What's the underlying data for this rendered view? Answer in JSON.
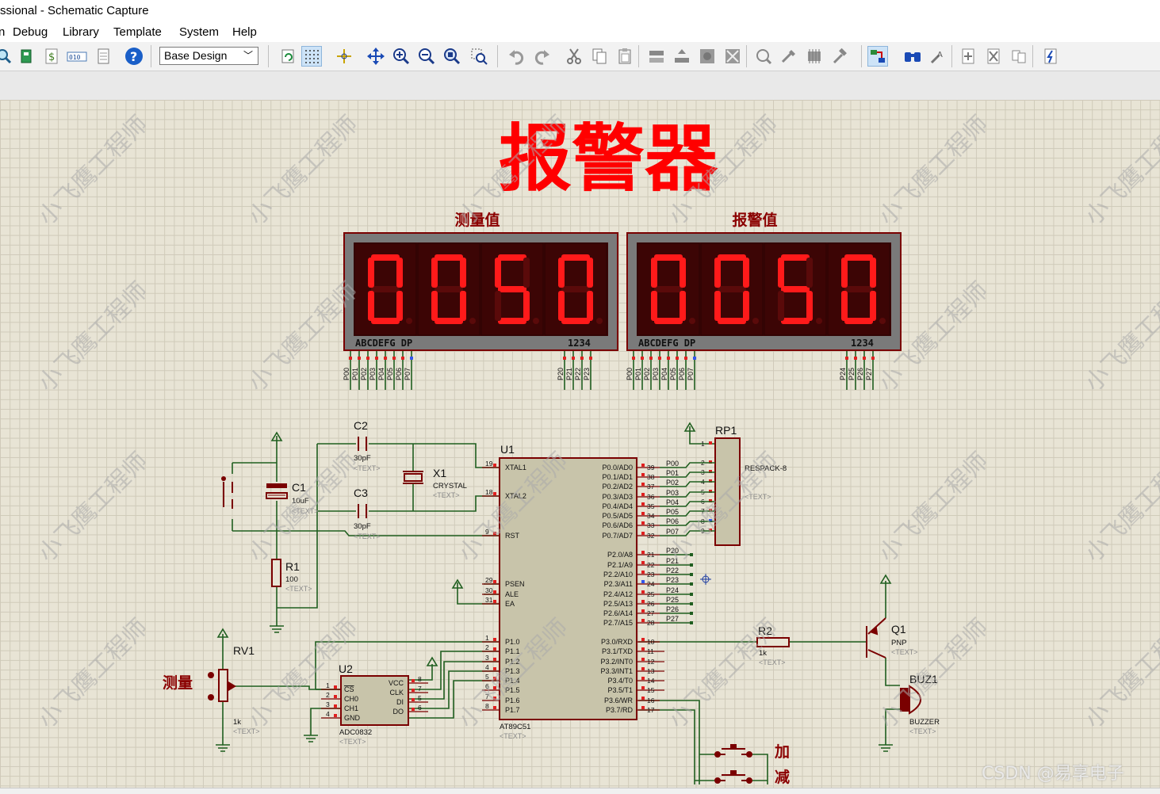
{
  "window": {
    "title": "ssional - Schematic Capture"
  },
  "menu": {
    "items": [
      "n",
      "Debug",
      "Library",
      "Template",
      "System",
      "Help"
    ]
  },
  "toolbar": {
    "layer_select": "Base Design",
    "icons": [
      "zoom-icon",
      "component-icon",
      "dollar-icon",
      "binary-icon",
      "document-icon",
      "help-icon",
      "refresh-icon",
      "grid-icon",
      "origin-icon",
      "pan-icon",
      "zoom-in-icon",
      "zoom-out-icon",
      "zoom-all-icon",
      "zoom-area-icon",
      "undo-icon",
      "redo-icon",
      "cut-icon",
      "copy-icon",
      "paste-icon",
      "block-copy-icon",
      "block-move-icon",
      "block-rotate-icon",
      "block-delete-icon",
      "pick-device-icon",
      "make-device-icon",
      "packaging-icon",
      "decompose-icon",
      "wire-autorouter-icon",
      "search-icon",
      "property-assign-icon",
      "new-sheet-icon",
      "delete-sheet-icon",
      "goto-sheet-icon",
      "netlist-icon"
    ]
  },
  "schematic": {
    "title": "报警器",
    "display1": {
      "caption": "测量值",
      "digits": "0050",
      "seg_label": "ABCDEFG  DP",
      "digit_label": "1234",
      "pins_a": [
        "P00",
        "P01",
        "P02",
        "P03",
        "P04",
        "P05",
        "P06",
        "P07"
      ],
      "pins_b": [
        "P20",
        "P21",
        "P22",
        "P23"
      ]
    },
    "display2": {
      "caption": "报警值",
      "digits": "0050",
      "seg_label": "ABCDEFG  DP",
      "digit_label": "1234",
      "pins_a": [
        "P00",
        "P01",
        "P02",
        "P03",
        "P04",
        "P05",
        "P06",
        "P07"
      ],
      "pins_b": [
        "P24",
        "P25",
        "P26",
        "P27"
      ]
    },
    "u1": {
      "ref": "U1",
      "part": "AT89C51",
      "text": "<TEXT>",
      "left_pins": [
        [
          "19",
          "XTAL1"
        ],
        [
          "18",
          "XTAL2"
        ],
        [
          "9",
          "RST"
        ],
        [
          "29",
          "PSEN"
        ],
        [
          "30",
          "ALE"
        ],
        [
          "31",
          "EA"
        ],
        [
          "1",
          "P1.0"
        ],
        [
          "2",
          "P1.1"
        ],
        [
          "3",
          "P1.2"
        ],
        [
          "4",
          "P1.3"
        ],
        [
          "5",
          "P1.4"
        ],
        [
          "6",
          "P1.5"
        ],
        [
          "7",
          "P1.6"
        ],
        [
          "8",
          "P1.7"
        ]
      ],
      "right_pins": [
        [
          "39",
          "P0.0/AD0",
          "P00"
        ],
        [
          "38",
          "P0.1/AD1",
          "P01"
        ],
        [
          "37",
          "P0.2/AD2",
          "P02"
        ],
        [
          "36",
          "P0.3/AD3",
          "P03"
        ],
        [
          "35",
          "P0.4/AD4",
          "P04"
        ],
        [
          "34",
          "P0.5/AD5",
          "P05"
        ],
        [
          "33",
          "P0.6/AD6",
          "P06"
        ],
        [
          "32",
          "P0.7/AD7",
          "P07"
        ],
        [
          "21",
          "P2.0/A8",
          "P20"
        ],
        [
          "22",
          "P2.1/A9",
          "P21"
        ],
        [
          "23",
          "P2.2/A10",
          "P22"
        ],
        [
          "24",
          "P2.3/A11",
          "P23"
        ],
        [
          "25",
          "P2.4/A12",
          "P24"
        ],
        [
          "26",
          "P2.5/A13",
          "P25"
        ],
        [
          "27",
          "P2.6/A14",
          "P26"
        ],
        [
          "28",
          "P2.7/A15",
          "P27"
        ],
        [
          "10",
          "P3.0/RXD",
          ""
        ],
        [
          "11",
          "P3.1/TXD",
          ""
        ],
        [
          "12",
          "P3.2/INT0",
          ""
        ],
        [
          "13",
          "P3.3/INT1",
          ""
        ],
        [
          "14",
          "P3.4/T0",
          ""
        ],
        [
          "15",
          "P3.5/T1",
          ""
        ],
        [
          "16",
          "P3.6/WR",
          ""
        ],
        [
          "17",
          "P3.7/RD",
          ""
        ]
      ]
    },
    "rp1": {
      "ref": "RP1",
      "part": "RESPACK-8",
      "text": "<TEXT>",
      "pins": [
        "1",
        "2",
        "3",
        "4",
        "5",
        "6",
        "7",
        "8",
        "9"
      ]
    },
    "c1": {
      "ref": "C1",
      "value": "10uF",
      "text": "<TEXT>"
    },
    "c2": {
      "ref": "C2",
      "value": "30pF",
      "text": "<TEXT>"
    },
    "c3": {
      "ref": "C3",
      "value": "30pF",
      "text": "<TEXT>"
    },
    "x1": {
      "ref": "X1",
      "value": "CRYSTAL",
      "text": "<TEXT>"
    },
    "r1": {
      "ref": "R1",
      "value": "100",
      "text": "<TEXT>"
    },
    "r2": {
      "ref": "R2",
      "value": "1k",
      "text": "<TEXT>"
    },
    "rv1": {
      "ref": "RV1",
      "value": "1k",
      "text": "<TEXT>",
      "label": "测量"
    },
    "u2": {
      "ref": "U2",
      "part": "ADC0832",
      "text": "<TEXT>",
      "left_pins": [
        [
          "1",
          "CS"
        ],
        [
          "2",
          "CH0"
        ],
        [
          "3",
          "CH1"
        ],
        [
          "4",
          "GND"
        ]
      ],
      "right_pins": [
        [
          "8",
          "VCC"
        ],
        [
          "7",
          "CLK"
        ],
        [
          "5",
          "DI"
        ],
        [
          "6",
          "DO"
        ]
      ]
    },
    "q1": {
      "ref": "Q1",
      "value": "PNP",
      "text": "<TEXT>"
    },
    "buz1": {
      "ref": "BUZ1",
      "value": "BUZZER",
      "text": "<TEXT>"
    },
    "buttons": {
      "add": "加",
      "sub": "减"
    },
    "watermark": "小飞鹰工程师"
  },
  "overlay": {
    "csdn": "CSDN @易享电子"
  },
  "colors": {
    "wire": "#1f5e1f",
    "component": "#7a0000",
    "body": "#c8c4aa",
    "title": "#ff0000",
    "segment": "#ff1a1a",
    "canvas": "#e8e4d5"
  }
}
